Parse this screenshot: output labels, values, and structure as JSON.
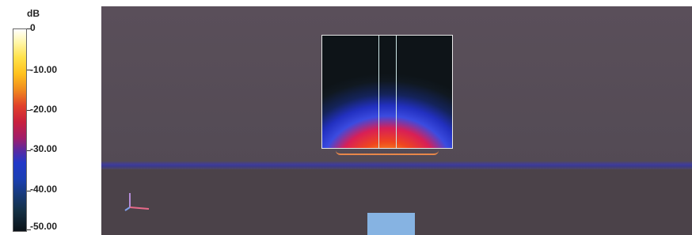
{
  "legend": {
    "unit": "dB",
    "top_label": "0",
    "labels": [
      "-10.00",
      "-20.00",
      "-30.00",
      "-40.00",
      "-50.00"
    ]
  },
  "colors": {
    "viewport_bg": "#544b55",
    "floor_line": "#3f3c9a",
    "field_hot": "#ffe060",
    "field_cold": "#0e1418",
    "block": "#86b3e2"
  },
  "icons": {
    "axis": "coordinate-axes-icon"
  }
}
